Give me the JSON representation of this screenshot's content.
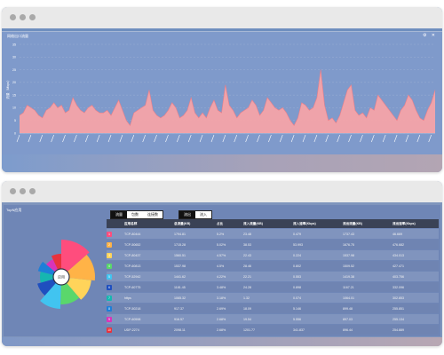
{
  "window1": {
    "panel_title": "网络出口流量",
    "tools": "⚙ ✕",
    "chart_data": {
      "type": "area",
      "ylabel": "流量（Mbps）",
      "ylim": [
        0,
        35
      ],
      "yticks": [
        "0",
        "5",
        "10",
        "15",
        "20",
        "25",
        "30",
        "35"
      ],
      "values": [
        7,
        8,
        11,
        10,
        9,
        7,
        6,
        9,
        10,
        12,
        10,
        11,
        8,
        9,
        14,
        11,
        9,
        8,
        10,
        11,
        9,
        8,
        8,
        9,
        7,
        10,
        13,
        9,
        5,
        3,
        8,
        9,
        10,
        11,
        17,
        9,
        7,
        6,
        7,
        9,
        12,
        10,
        6,
        7,
        9,
        14,
        8,
        6,
        8,
        6,
        10,
        13,
        9,
        8,
        19,
        11,
        9,
        6,
        8,
        9,
        10,
        13,
        11,
        7,
        9,
        14,
        12,
        10,
        9,
        10,
        8,
        5,
        3,
        6,
        12,
        11,
        9,
        10,
        14,
        25,
        11,
        5,
        6,
        4,
        7,
        12,
        17,
        19,
        9,
        7,
        8,
        6,
        10,
        9,
        15,
        13,
        11,
        9,
        7,
        5,
        9,
        11,
        15,
        13,
        9,
        6,
        5,
        9,
        12,
        17
      ]
    }
  },
  "window2": {
    "panel_title": "TopN应用",
    "tabs_a": [
      "流量",
      "包数",
      "连接数"
    ],
    "tabs_b": [
      "流出",
      "流入"
    ],
    "center_label": "应用",
    "columns": [
      "应用名称",
      "总流量(KB)",
      "占比",
      "流入流量(KB)",
      "流入速率(Kbps)",
      "流出流量(KB)",
      "流出速率(Kbps)"
    ],
    "rows": [
      {
        "rank": "1",
        "color": "#ff4d7d",
        "name": "TCP-80444",
        "total": "1794.81",
        "pct": "5.2%",
        "in_traffic": "23.48",
        "in_rate": "0.479",
        "out_traffic": "1737.43",
        "out_rate": "46.669"
      },
      {
        "rank": "2",
        "color": "#ffb347",
        "name": "TCP-50652",
        "total": "1715.28",
        "pct": "5.02%",
        "in_traffic": "38.53",
        "in_rate": "53.993",
        "out_traffic": "1676.75",
        "out_rate": "476.682"
      },
      {
        "rank": "3",
        "color": "#ffd45a",
        "name": "TCP-80437",
        "total": "1560.51",
        "pct": "4.57%",
        "in_traffic": "22.43",
        "in_rate": "0.224",
        "out_traffic": "1537.98",
        "out_rate": "434.013"
      },
      {
        "rank": "4",
        "color": "#5ad76b",
        "name": "TCP-60813",
        "total": "1537.98",
        "pct": "4.5%",
        "in_traffic": "28.46",
        "in_rate": "0.802",
        "out_traffic": "1509.52",
        "out_rate": "427.471"
      },
      {
        "rank": "5",
        "color": "#41c4f0",
        "name": "TCP-52942",
        "total": "1441.62",
        "pct": "4.22%",
        "in_traffic": "22.21",
        "in_rate": "0.553",
        "out_traffic": "1419.38",
        "out_rate": "403.756"
      },
      {
        "rank": "6",
        "color": "#1f4fbf",
        "name": "TCP-60775",
        "total": "1181.45",
        "pct": "3.48%",
        "in_traffic": "24.28",
        "in_rate": "0.898",
        "out_traffic": "1167.21",
        "out_rate": "332.096"
      },
      {
        "rank": "7",
        "color": "#16b6b0",
        "name": "https",
        "total": "1065.32",
        "pct": "3.18%",
        "in_traffic": "1.32",
        "in_rate": "0.074",
        "out_traffic": "1064.01",
        "out_rate": "302.853"
      },
      {
        "rank": "8",
        "color": "#1d7fd8",
        "name": "TCP-50218",
        "total": "917.37",
        "pct": "2.69%",
        "in_traffic": "18.09",
        "in_rate": "5.146",
        "out_traffic": "899.48",
        "out_rate": "255.851"
      },
      {
        "rank": "9",
        "color": "#d934b8",
        "name": "TCP-60598",
        "total": "916.57",
        "pct": "2.68%",
        "in_traffic": "19.54",
        "in_rate": "5.556",
        "out_traffic": "897.03",
        "out_rate": "255.134"
      },
      {
        "rank": "10",
        "color": "#e8323c",
        "name": "UDP-2274",
        "total": "2098.11",
        "pct": "2.68%",
        "in_traffic": "1201.77",
        "in_rate": "341.837",
        "out_traffic": "896.44",
        "out_rate": "254.889"
      }
    ],
    "pie": [
      {
        "color": "#ff4d7d",
        "value": 5.2
      },
      {
        "color": "#ffb347",
        "value": 5.02
      },
      {
        "color": "#ffd45a",
        "value": 4.57
      },
      {
        "color": "#5ad76b",
        "value": 4.5
      },
      {
        "color": "#41c4f0",
        "value": 4.22
      },
      {
        "color": "#1f4fbf",
        "value": 3.48
      },
      {
        "color": "#16b6b0",
        "value": 3.18
      },
      {
        "color": "#1d7fd8",
        "value": 2.69
      },
      {
        "color": "#d934b8",
        "value": 2.68
      },
      {
        "color": "#e8323c",
        "value": 2.68
      }
    ]
  }
}
